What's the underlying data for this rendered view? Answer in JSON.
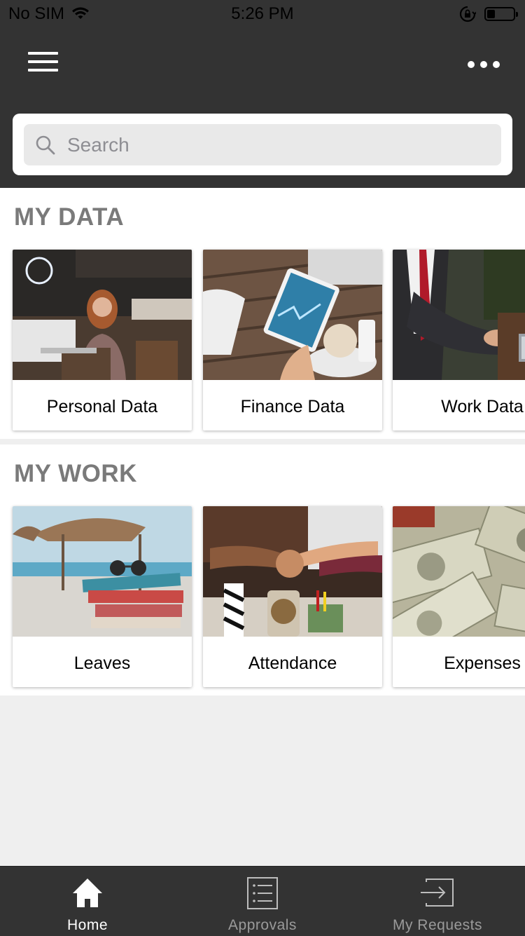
{
  "status_bar": {
    "carrier": "No SIM",
    "time": "5:26 PM"
  },
  "search": {
    "placeholder": "Search"
  },
  "sections": [
    {
      "title": "MY DATA",
      "cards": [
        {
          "label": "Personal Data"
        },
        {
          "label": "Finance Data"
        },
        {
          "label": "Work Data"
        }
      ]
    },
    {
      "title": "MY WORK",
      "cards": [
        {
          "label": "Leaves"
        },
        {
          "label": "Attendance"
        },
        {
          "label": "Expenses"
        }
      ]
    }
  ],
  "tabbar": {
    "tabs": [
      {
        "label": "Home",
        "icon": "home-icon"
      },
      {
        "label": "Approvals",
        "icon": "list-icon"
      },
      {
        "label": "My Requests",
        "icon": "request-icon"
      }
    ],
    "active": "Home"
  },
  "colors": {
    "header": "#333333",
    "tabbar": "#333333",
    "section_title": "#7a7a7a",
    "background": "#efefef"
  }
}
